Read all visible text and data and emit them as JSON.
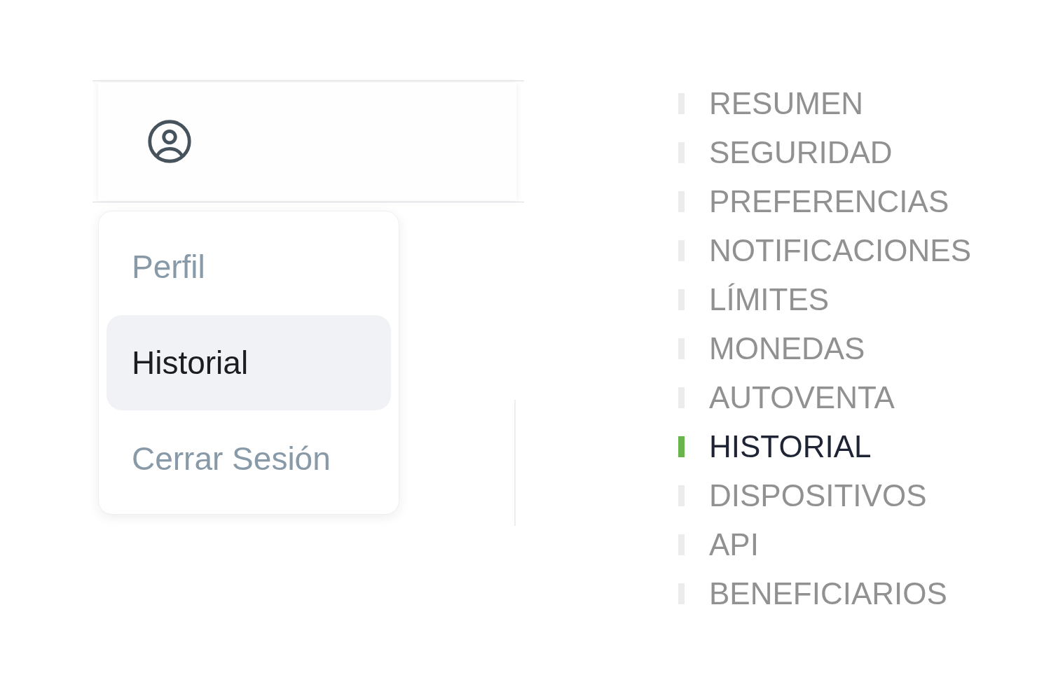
{
  "user_menu": {
    "items": [
      {
        "label": "Perfil",
        "selected": false
      },
      {
        "label": "Historial",
        "selected": true
      },
      {
        "label": "Cerrar Sesión",
        "selected": false
      }
    ]
  },
  "settings_nav": {
    "items": [
      {
        "label": "RESUMEN",
        "selected": false
      },
      {
        "label": "SEGURIDAD",
        "selected": false
      },
      {
        "label": "PREFERENCIAS",
        "selected": false
      },
      {
        "label": "NOTIFICACIONES",
        "selected": false
      },
      {
        "label": "LÍMITES",
        "selected": false
      },
      {
        "label": "MONEDAS",
        "selected": false
      },
      {
        "label": "AUTOVENTA",
        "selected": false
      },
      {
        "label": "HISTORIAL",
        "selected": true
      },
      {
        "label": "DISPOSITIVOS",
        "selected": false
      },
      {
        "label": "API",
        "selected": false
      },
      {
        "label": "BENEFICIARIOS",
        "selected": false
      }
    ]
  }
}
